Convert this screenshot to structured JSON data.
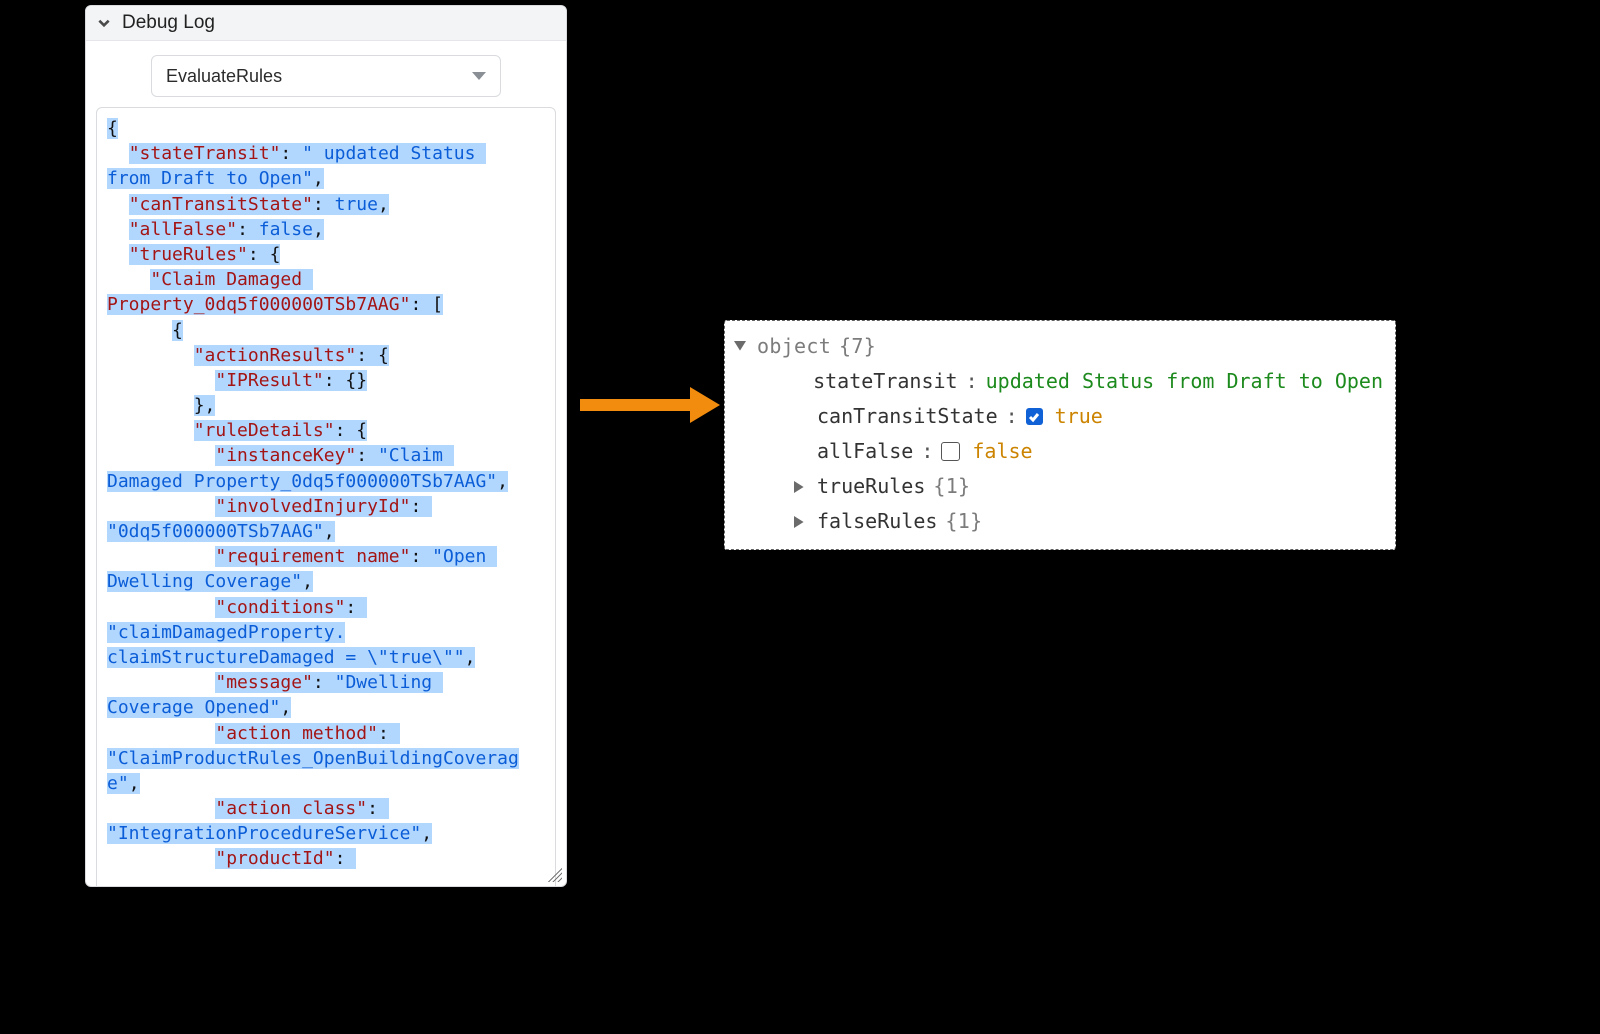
{
  "panel": {
    "title": "Debug Log",
    "select_value": "EvaluateRules"
  },
  "json_tokens": [
    {
      "cls": "p hl",
      "txt": "{"
    },
    {
      "br": true
    },
    {
      "cls": "p",
      "txt": "  "
    },
    {
      "cls": "k hl",
      "txt": "\"stateTransit\""
    },
    {
      "cls": "p hl",
      "txt": ": "
    },
    {
      "cls": "s hl",
      "txt": "\" updated Status "
    },
    {
      "br": true
    },
    {
      "cls": "s hl",
      "txt": "from Draft to Open\""
    },
    {
      "cls": "p hl",
      "txt": ","
    },
    {
      "br": true
    },
    {
      "cls": "p",
      "txt": "  "
    },
    {
      "cls": "k hl",
      "txt": "\"canTransitState\""
    },
    {
      "cls": "p hl",
      "txt": ": "
    },
    {
      "cls": "n hl",
      "txt": "true"
    },
    {
      "cls": "p hl",
      "txt": ","
    },
    {
      "br": true
    },
    {
      "cls": "p",
      "txt": "  "
    },
    {
      "cls": "k hl",
      "txt": "\"allFalse\""
    },
    {
      "cls": "p hl",
      "txt": ": "
    },
    {
      "cls": "n hl",
      "txt": "false"
    },
    {
      "cls": "p hl",
      "txt": ","
    },
    {
      "br": true
    },
    {
      "cls": "p",
      "txt": "  "
    },
    {
      "cls": "k hl",
      "txt": "\"trueRules\""
    },
    {
      "cls": "p hl",
      "txt": ": {"
    },
    {
      "br": true
    },
    {
      "cls": "p",
      "txt": "    "
    },
    {
      "cls": "k hl",
      "txt": "\"Claim Damaged "
    },
    {
      "br": true
    },
    {
      "cls": "k hl",
      "txt": "Property_0dq5f000000TSb7AAG\""
    },
    {
      "cls": "p hl",
      "txt": ": ["
    },
    {
      "br": true
    },
    {
      "cls": "p",
      "txt": "      "
    },
    {
      "cls": "p hl",
      "txt": "{"
    },
    {
      "br": true
    },
    {
      "cls": "p",
      "txt": "        "
    },
    {
      "cls": "k hl",
      "txt": "\"actionResults\""
    },
    {
      "cls": "p hl",
      "txt": ": {"
    },
    {
      "br": true
    },
    {
      "cls": "p",
      "txt": "          "
    },
    {
      "cls": "k hl",
      "txt": "\"IPResult\""
    },
    {
      "cls": "p hl",
      "txt": ": {}"
    },
    {
      "br": true
    },
    {
      "cls": "p",
      "txt": "        "
    },
    {
      "cls": "p hl",
      "txt": "},"
    },
    {
      "br": true
    },
    {
      "cls": "p",
      "txt": "        "
    },
    {
      "cls": "k hl",
      "txt": "\"ruleDetails\""
    },
    {
      "cls": "p hl",
      "txt": ": {"
    },
    {
      "br": true
    },
    {
      "cls": "p",
      "txt": "          "
    },
    {
      "cls": "k hl",
      "txt": "\"instanceKey\""
    },
    {
      "cls": "p hl",
      "txt": ": "
    },
    {
      "cls": "s hl",
      "txt": "\"Claim "
    },
    {
      "br": true
    },
    {
      "cls": "s hl",
      "txt": "Damaged Property_0dq5f000000TSb7AAG\""
    },
    {
      "cls": "p hl",
      "txt": ","
    },
    {
      "br": true
    },
    {
      "cls": "p",
      "txt": "          "
    },
    {
      "cls": "k hl",
      "txt": "\"involvedInjuryId\""
    },
    {
      "cls": "p hl",
      "txt": ": "
    },
    {
      "br": true
    },
    {
      "cls": "s hl",
      "txt": "\"0dq5f000000TSb7AAG\""
    },
    {
      "cls": "p hl",
      "txt": ","
    },
    {
      "br": true
    },
    {
      "cls": "p",
      "txt": "          "
    },
    {
      "cls": "k hl",
      "txt": "\"requirement name\""
    },
    {
      "cls": "p hl",
      "txt": ": "
    },
    {
      "cls": "s hl",
      "txt": "\"Open "
    },
    {
      "br": true
    },
    {
      "cls": "s hl",
      "txt": "Dwelling Coverage\""
    },
    {
      "cls": "p hl",
      "txt": ","
    },
    {
      "br": true
    },
    {
      "cls": "p",
      "txt": "          "
    },
    {
      "cls": "k hl",
      "txt": "\"conditions\""
    },
    {
      "cls": "p hl",
      "txt": ": "
    },
    {
      "br": true
    },
    {
      "cls": "s hl",
      "txt": "\"claimDamagedProperty."
    },
    {
      "br": true
    },
    {
      "cls": "s hl",
      "txt": "claimStructureDamaged = \\\"true\\\"\""
    },
    {
      "cls": "p hl",
      "txt": ","
    },
    {
      "br": true
    },
    {
      "cls": "p",
      "txt": "          "
    },
    {
      "cls": "k hl",
      "txt": "\"message\""
    },
    {
      "cls": "p hl",
      "txt": ": "
    },
    {
      "cls": "s hl",
      "txt": "\"Dwelling "
    },
    {
      "br": true
    },
    {
      "cls": "s hl",
      "txt": "Coverage Opened\""
    },
    {
      "cls": "p hl",
      "txt": ","
    },
    {
      "br": true
    },
    {
      "cls": "p",
      "txt": "          "
    },
    {
      "cls": "k hl",
      "txt": "\"action method\""
    },
    {
      "cls": "p hl",
      "txt": ": "
    },
    {
      "br": true
    },
    {
      "cls": "s hl",
      "txt": "\"ClaimProductRules_OpenBuildingCoverag"
    },
    {
      "br": true
    },
    {
      "cls": "s hl",
      "txt": "e\""
    },
    {
      "cls": "p hl",
      "txt": ","
    },
    {
      "br": true
    },
    {
      "cls": "p",
      "txt": "          "
    },
    {
      "cls": "k hl",
      "txt": "\"action class\""
    },
    {
      "cls": "p hl",
      "txt": ": "
    },
    {
      "br": true
    },
    {
      "cls": "s hl",
      "txt": "\"IntegrationProcedureService\""
    },
    {
      "cls": "p hl",
      "txt": ","
    },
    {
      "br": true
    },
    {
      "cls": "p",
      "txt": "          "
    },
    {
      "cls": "k hl",
      "txt": "\"productId\""
    },
    {
      "cls": "p hl",
      "txt": ": "
    }
  ],
  "tree": {
    "root_label": "object",
    "root_count": "{7}",
    "rows": [
      {
        "key": "stateTransit",
        "sep": ":",
        "value": " updated Status from Draft to Open",
        "value_cls": "val-green",
        "chk": null,
        "toggle": null
      },
      {
        "key": "canTransitState",
        "sep": ":",
        "value": "true",
        "value_cls": "val-amber",
        "chk": "on",
        "toggle": null
      },
      {
        "key": "allFalse",
        "sep": ":",
        "value": "false",
        "value_cls": "val-amber",
        "chk": "off",
        "toggle": null
      },
      {
        "key": "trueRules",
        "sep": "",
        "value": "{1}",
        "value_cls": "obj-grey",
        "chk": null,
        "toggle": "right"
      },
      {
        "key": "falseRules",
        "sep": "",
        "value": "{1}",
        "value_cls": "obj-grey",
        "chk": null,
        "toggle": "right"
      }
    ]
  }
}
